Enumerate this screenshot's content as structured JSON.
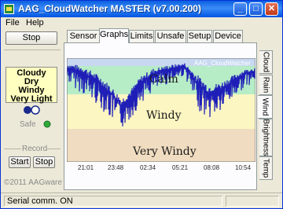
{
  "window": {
    "title": "AAG_CloudWatcher MASTER (v7.00.200)",
    "minimize_glyph": "_",
    "maximize_glyph": "□",
    "close_glyph": "✕"
  },
  "menu": {
    "file": "File",
    "help": "Help"
  },
  "left_panel": {
    "stop_label": "Stop",
    "status": [
      "Cloudy",
      "Dry",
      "Windy",
      "Very Light"
    ],
    "safe_label": "Safe",
    "record_label": "Record",
    "start_label": "Start",
    "record_stop_label": "Stop",
    "copyright": "©2011 AAGware"
  },
  "tabs": [
    "Sensor",
    "Graphs",
    "Limits",
    "Unsafe",
    "Setup",
    "Device"
  ],
  "active_tab": "Graphs",
  "side_tabs": [
    "Cloud",
    "Rain",
    "Wind",
    "Brightness",
    "Temp"
  ],
  "active_side_tab": "Wind",
  "chart": {
    "legend": "AAG_CloudWatcher",
    "zones": [
      "Calm",
      "Windy",
      "Very Windy"
    ],
    "x_ticks": [
      "21:01",
      "23:48",
      "02:34",
      "05:21",
      "08:08",
      "10:54"
    ]
  },
  "statusbar": {
    "text": "Serial comm. ON"
  },
  "colors": {
    "calm_zone": "#b6ecc6",
    "windy_zone": "#fbf6c2",
    "very_windy_zone": "#f0dcc0",
    "plot_top": "#c8d8f0",
    "series": "#1f1fb8",
    "safe_indicator": "#2faa3a"
  }
}
